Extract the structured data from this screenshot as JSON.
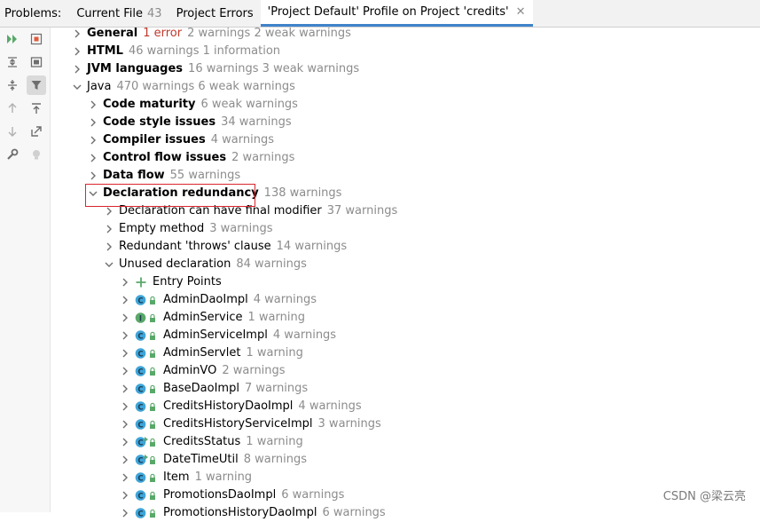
{
  "tabs": {
    "title": "Problems:",
    "current_file": {
      "label": "Current File",
      "count": "43"
    },
    "project_errors": {
      "label": "Project Errors"
    },
    "profile": {
      "label": "'Project Default' Profile on Project 'credits'",
      "close": "✕"
    }
  },
  "toolbar_icons": [
    "run-icon",
    "stop-icon",
    "expand-all-icon",
    "layout-icon",
    "collapse-all-icon",
    "filter-icon",
    "up-arrow-icon",
    "export-icon",
    "down-arrow-icon",
    "open-external-icon",
    "wrench-icon",
    "lightbulb-icon"
  ],
  "tree": {
    "general": {
      "name": "General",
      "error": "1 error",
      "count": "2 warnings 2 weak warnings"
    },
    "html": {
      "name": "HTML",
      "count": "46 warnings 1 information"
    },
    "jvm": {
      "name": "JVM languages",
      "count": "16 warnings 3 weak warnings"
    },
    "java": {
      "name": "Java",
      "count": "470 warnings 6 weak warnings"
    },
    "code_maturity": {
      "name": "Code maturity",
      "count": "6 weak warnings"
    },
    "code_style": {
      "name": "Code style issues",
      "count": "34 warnings"
    },
    "compiler": {
      "name": "Compiler issues",
      "count": "4 warnings"
    },
    "control_flow": {
      "name": "Control flow issues",
      "count": "2 warnings"
    },
    "data_flow": {
      "name": "Data flow",
      "count": "55 warnings"
    },
    "decl_redundancy": {
      "name": "Declaration redundancy",
      "count": "138 warnings"
    },
    "decl_final": {
      "name": "Declaration can have final modifier",
      "count": "37 warnings"
    },
    "empty_method": {
      "name": "Empty method",
      "count": "3 warnings"
    },
    "redundant_throws": {
      "name": "Redundant 'throws' clause",
      "count": "14 warnings"
    },
    "unused_decl": {
      "name": "Unused declaration",
      "count": "84 warnings"
    },
    "entry_points": {
      "name": "Entry Points"
    },
    "classes": [
      {
        "name": "AdminDaoImpl",
        "count": "4 warnings",
        "kind": "C"
      },
      {
        "name": "AdminService",
        "count": "1 warning",
        "kind": "I"
      },
      {
        "name": "AdminServiceImpl",
        "count": "4 warnings",
        "kind": "C"
      },
      {
        "name": "AdminServlet",
        "count": "1 warning",
        "kind": "C"
      },
      {
        "name": "AdminVO",
        "count": "2 warnings",
        "kind": "C"
      },
      {
        "name": "BaseDaoImpl",
        "count": "7 warnings",
        "kind": "C"
      },
      {
        "name": "CreditsHistoryDaoImpl",
        "count": "4 warnings",
        "kind": "C"
      },
      {
        "name": "CreditsHistoryServiceImpl",
        "count": "3 warnings",
        "kind": "C"
      },
      {
        "name": "CreditsStatus",
        "count": "1 warning",
        "kind": "CR"
      },
      {
        "name": "DateTimeUtil",
        "count": "8 warnings",
        "kind": "CR"
      },
      {
        "name": "Item",
        "count": "1 warning",
        "kind": "C"
      },
      {
        "name": "PromotionsDaoImpl",
        "count": "6 warnings",
        "kind": "C"
      },
      {
        "name": "PromotionsHistoryDaoImpl",
        "count": "6 warnings",
        "kind": "C"
      }
    ]
  },
  "watermark": "CSDN @梁云亮",
  "colors": {
    "error": "#c0392b",
    "count": "#8c8c8c",
    "highlight": "#d9252c",
    "accent": "#4083c9",
    "class_icon": "#3da5d9",
    "interface_icon": "#59a869"
  }
}
